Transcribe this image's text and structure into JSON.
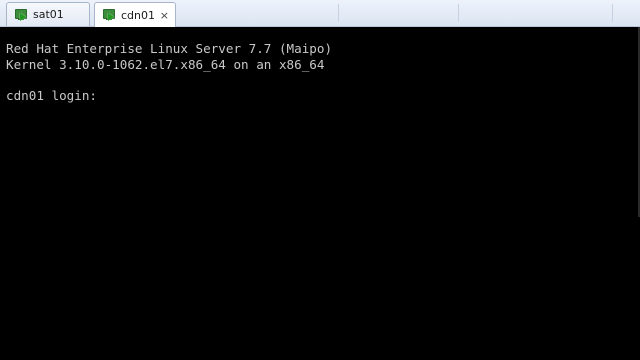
{
  "tabs": [
    {
      "label": "sat01",
      "active": false,
      "icon": "vm-running-icon"
    },
    {
      "label": "cdn01",
      "active": true,
      "icon": "vm-running-icon"
    }
  ],
  "close_glyph": "×",
  "console": {
    "lines": [
      "Red Hat Enterprise Linux Server 7.7 (Maipo)",
      "Kernel 3.10.0-1062.el7.x86_64 on an x86_64",
      "cdn01 login:"
    ]
  },
  "colors": {
    "console_bg": "#000000",
    "console_text": "#c8c8c8",
    "tabbar_bg": "#dbe4f2",
    "vm_icon": "#3c8d3c"
  }
}
